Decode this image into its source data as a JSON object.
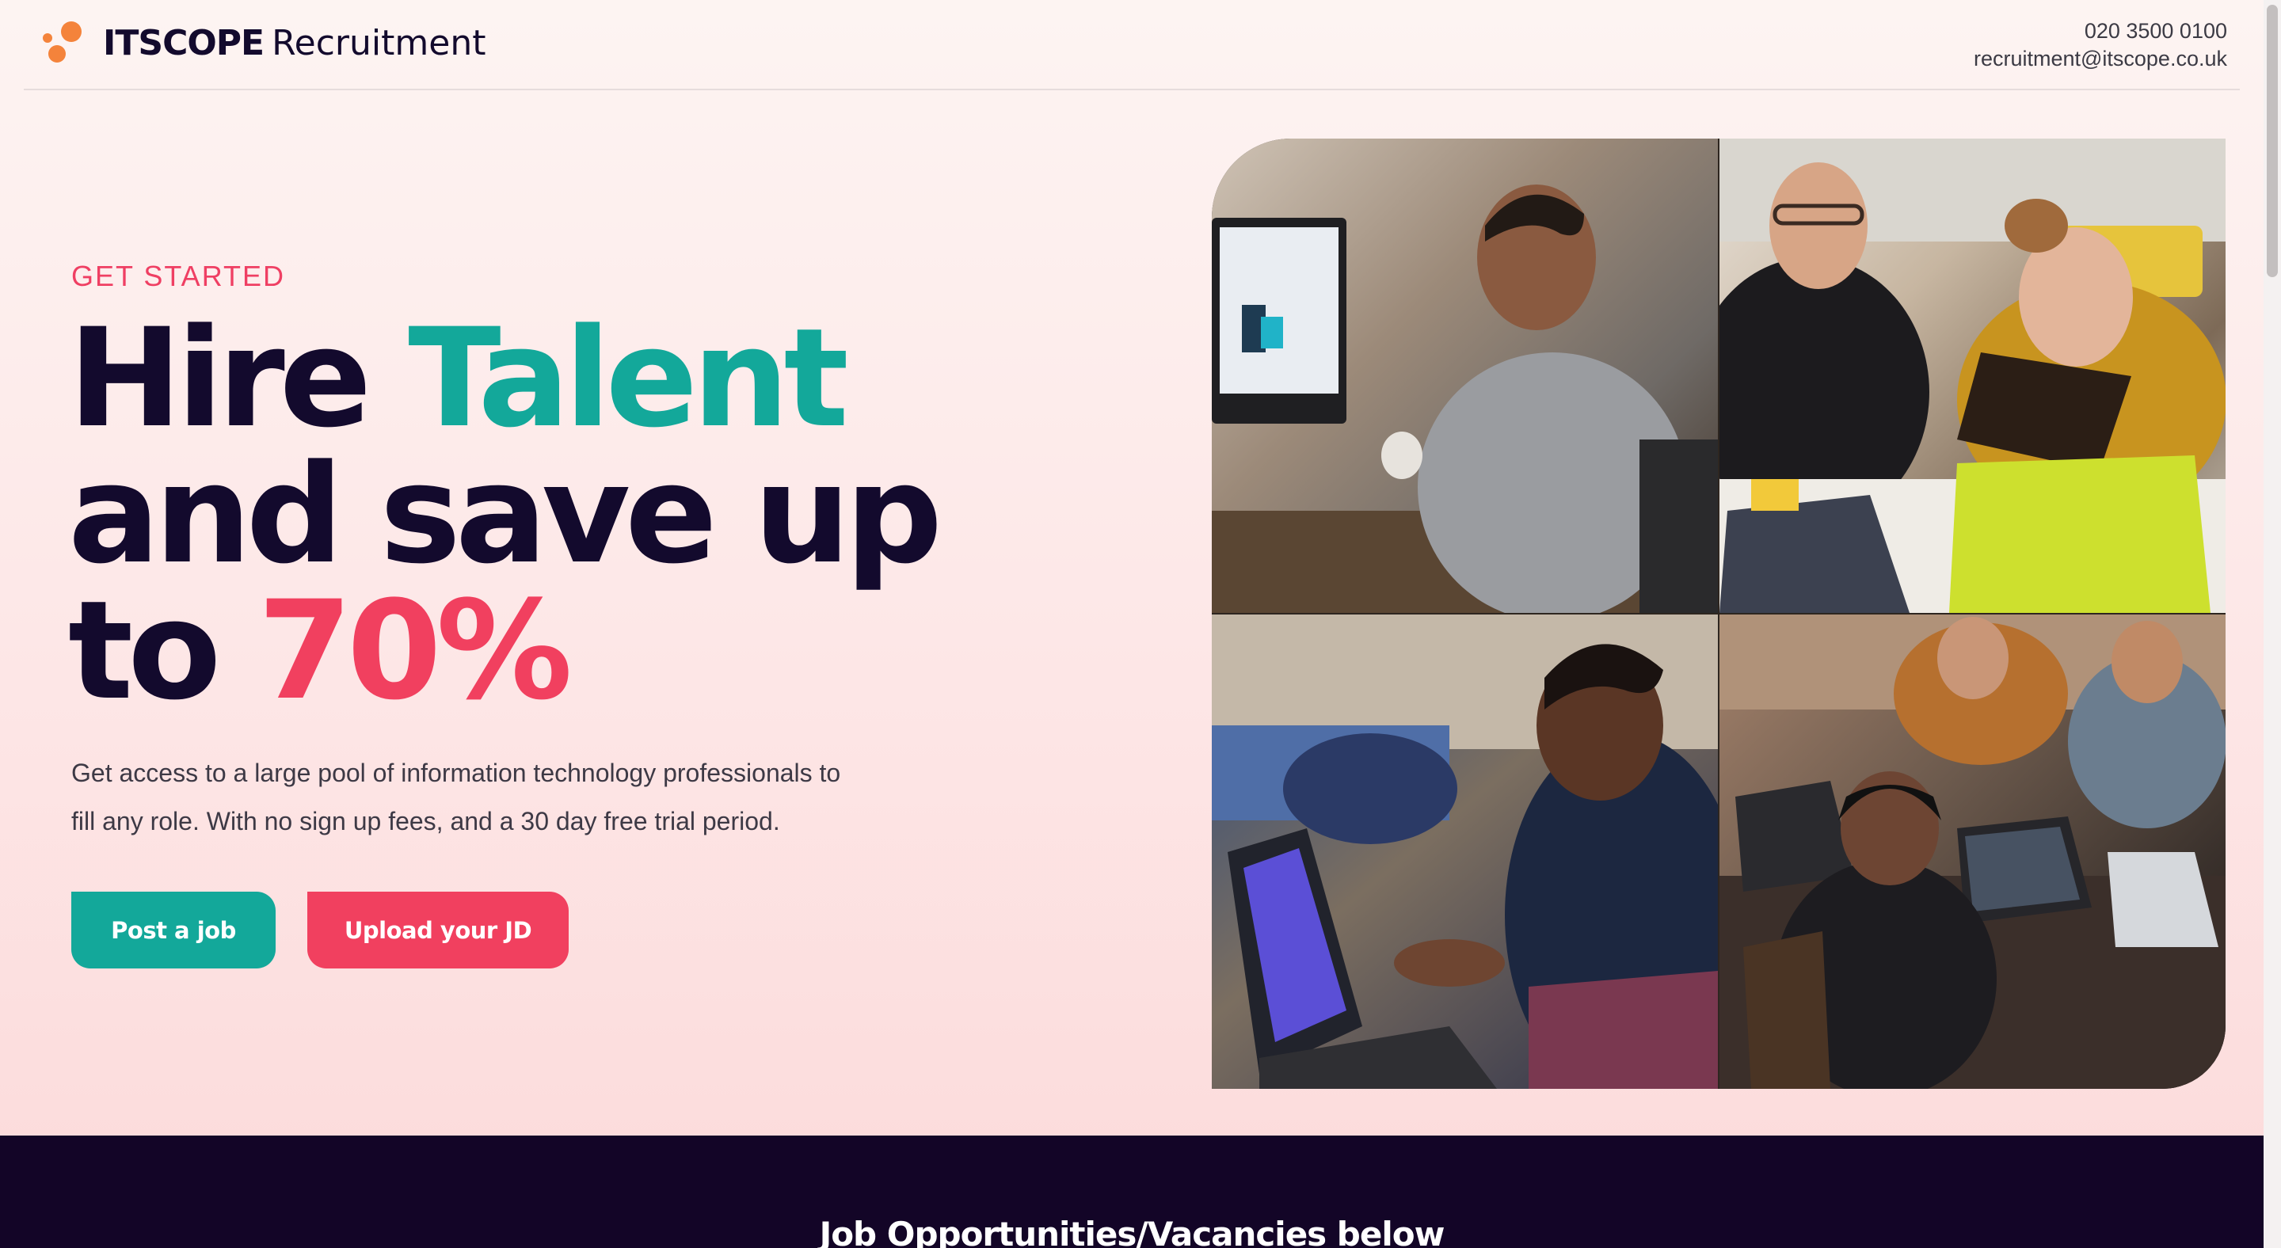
{
  "header": {
    "brand": "ITSCOPE",
    "brand_suffix": "Recruitment",
    "phone": "020 3500 0100",
    "email": "recruitment@itscope.co.uk"
  },
  "hero": {
    "eyebrow": "GET STARTED",
    "headline": {
      "hire": "Hire",
      "talent": "Talent",
      "line2": "and save up",
      "to": "to",
      "percent": "70%"
    },
    "description": "Get access to a large pool of information technology professionals to fill any role. With no sign up fees, and a 30 day free trial period.",
    "post_job_label": "Post a job",
    "upload_jd_label": "Upload your JD"
  },
  "images": [
    "office-worker-photo",
    "team-laughing-photo",
    "developer-laptop-photo",
    "team-coding-photo"
  ],
  "section": {
    "title": "Job Opportunities/Vacancies below"
  },
  "colors": {
    "navy": "#130a2d",
    "teal": "#13a89a",
    "pink": "#f1405f",
    "band": "#130527",
    "logo_orange": "#f4833b"
  }
}
